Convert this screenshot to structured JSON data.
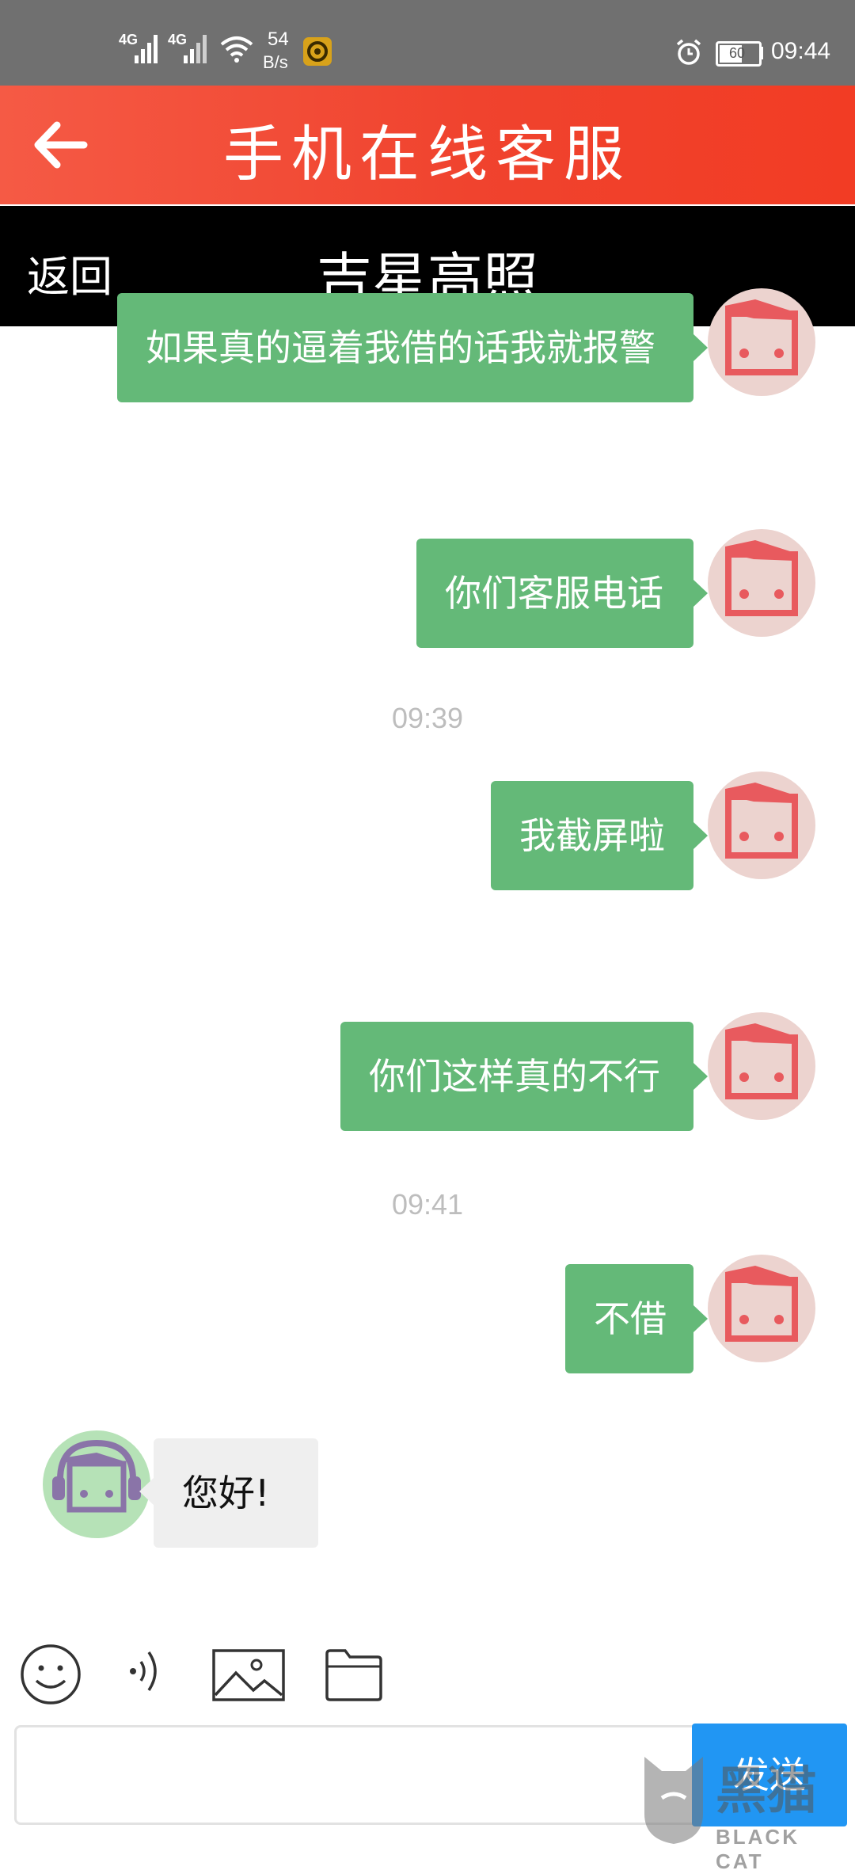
{
  "status_bar": {
    "net1": "4G",
    "net2": "4G",
    "speed_value": "54",
    "speed_unit": "B/s",
    "battery": "60",
    "time": "09:44"
  },
  "header": {
    "title": "手机在线客服",
    "back_label": "返回",
    "contact_name": "吉星高照"
  },
  "messages": [
    {
      "text": "如果真的逼着我借的话我就报警",
      "side": "out"
    },
    {
      "text": "你们客服电话",
      "side": "out"
    },
    {
      "text": "09:39",
      "type": "time"
    },
    {
      "text": "我截屏啦",
      "side": "out"
    },
    {
      "text": "你们这样真的不行",
      "side": "out"
    },
    {
      "text": "09:41",
      "type": "time"
    },
    {
      "text": "不借",
      "side": "out"
    },
    {
      "text": "您好!",
      "side": "in"
    }
  ],
  "input": {
    "placeholder": "",
    "send_label": "发送"
  },
  "toolbar": {
    "icons": [
      "emoji-icon",
      "voice-icon",
      "image-icon",
      "folder-icon"
    ]
  },
  "watermark": {
    "text": "BLACK CAT",
    "cn": "黑猫"
  },
  "colors": {
    "out_bubble": "#64b978",
    "in_bubble": "#efefef",
    "title_bar": "#f0432e",
    "send": "#2196f3"
  }
}
